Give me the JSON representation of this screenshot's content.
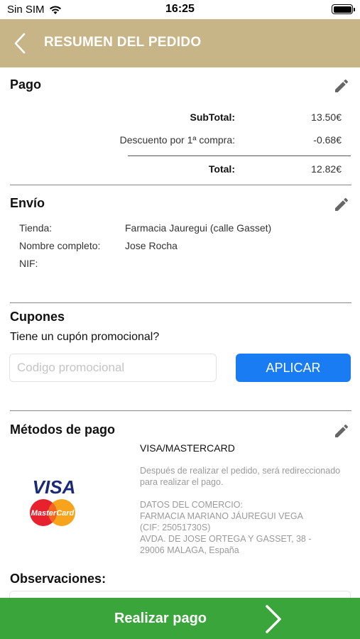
{
  "status_bar": {
    "carrier": "Sin SIM",
    "time": "16:25"
  },
  "nav": {
    "title": "RESUMEN DEL PEDIDO"
  },
  "payment": {
    "title": "Pago",
    "subtotal_label": "SubTotal:",
    "subtotal_value": "13.50€",
    "discount_label": "Descuento por 1ª compra:",
    "discount_value": "-0.68€",
    "total_label": "Total:",
    "total_value": "12.82€"
  },
  "shipping": {
    "title": "Envío",
    "store_label": "Tienda:",
    "store_value": "Farmacia Jauregui (calle Gasset)",
    "name_label": "Nombre completo:",
    "name_value": "Jose Rocha",
    "nif_label": "NIF:",
    "nif_value": ""
  },
  "coupons": {
    "title": "Cupones",
    "question": "Tiene un cupón promocional?",
    "input_value": "",
    "input_placeholder": "Codigo promocional",
    "apply_label": "APLICAR"
  },
  "payment_methods": {
    "title": "Métodos de pago",
    "method_name": "VISA/MASTERCARD",
    "note": "Después de realizar el pedido, será redireccionado para realizar el pago.",
    "merchant_lines": [
      "DATOS DEL COMERCIO:",
      "FARMACIA MARIANO JÁUREGUI VEGA",
      "(CIF: 25051730S)",
      "AVDA. DE JOSE ORTEGA Y GASSET, 38 -",
      "29006 MALAGA, España"
    ],
    "visa_logo_text": "VISA",
    "mastercard_logo_text": "MasterCard"
  },
  "observations": {
    "title": "Observaciones:"
  },
  "footer": {
    "pay_label": "Realizar pago"
  },
  "colors": {
    "navbar": "#c8b587",
    "apply_button": "#1a7cf3",
    "pay_button": "#3aa53b"
  }
}
